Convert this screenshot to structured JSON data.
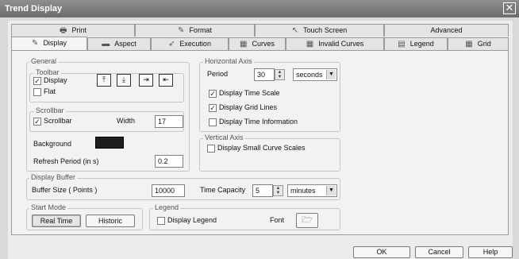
{
  "window": {
    "title": "Trend Display",
    "close_label": "✕"
  },
  "tabs_row1": [
    {
      "label": "Print",
      "icon": "printer-icon",
      "glyph": "🖶"
    },
    {
      "label": "Format",
      "icon": "pen-format-icon",
      "glyph": "✎"
    },
    {
      "label": "Touch Screen",
      "icon": "touch-pointer-icon",
      "glyph": "↖"
    },
    {
      "label": "Advanced",
      "icon": "",
      "glyph": ""
    }
  ],
  "tabs_row2": [
    {
      "label": "Display",
      "icon": "pencil-icon",
      "glyph": "✎",
      "active": true
    },
    {
      "label": "Aspect",
      "icon": "aspect-icon",
      "glyph": "▬"
    },
    {
      "label": "Execution",
      "icon": "execution-icon",
      "glyph": "➶"
    },
    {
      "label": "Curves",
      "icon": "curves-grid-icon",
      "glyph": "▦"
    },
    {
      "label": "Invalid Curves",
      "icon": "invalid-curves-icon",
      "glyph": "▦"
    },
    {
      "label": "Legend",
      "icon": "legend-icon",
      "glyph": "▤"
    },
    {
      "label": "Grid",
      "icon": "grid-icon",
      "glyph": "▦"
    }
  ],
  "general": {
    "title": "General",
    "toolbar": {
      "title": "Toolbar",
      "display_label": "Display",
      "display_checked": true,
      "flat_label": "Flat",
      "flat_checked": false,
      "buttons": [
        {
          "name": "toolbar-top-icon",
          "glyph": "⤒"
        },
        {
          "name": "toolbar-bottom-icon",
          "glyph": "⤓"
        },
        {
          "name": "toolbar-right-icon",
          "glyph": "⇥"
        },
        {
          "name": "toolbar-left-icon",
          "glyph": "⇤"
        }
      ]
    },
    "scrollbar": {
      "title": "Scrollbar",
      "scrollbar_label": "Scrollbar",
      "scrollbar_checked": true,
      "width_label": "Width",
      "width_value": "17"
    },
    "background_label": "Background",
    "background_color": "#1e1e1e",
    "refresh_label": "Refresh Period (in s)",
    "refresh_value": "0.2"
  },
  "horizontal_axis": {
    "title": "Horizontal Axis",
    "period_label": "Period",
    "period_value": "30",
    "period_unit": "seconds",
    "display_time_scale_label": "Display Time Scale",
    "display_time_scale_checked": true,
    "display_grid_lines_label": "Display Grid Lines",
    "display_grid_lines_checked": true,
    "display_time_info_label": "Display Time Information",
    "display_time_info_checked": false
  },
  "vertical_axis": {
    "title": "Vertical Axis",
    "small_scales_label": "Display Small Curve Scales",
    "small_scales_checked": false
  },
  "display_buffer": {
    "title": "Display Buffer",
    "buffer_size_label": "Buffer Size ( Points )",
    "buffer_size_value": "10000",
    "time_capacity_label": "Time Capacity",
    "time_capacity_value": "5",
    "time_capacity_unit": "minutes"
  },
  "start_mode": {
    "title": "Start Mode",
    "real_time_label": "Real Time",
    "historic_label": "Historic"
  },
  "legend_group": {
    "title": "Legend",
    "display_legend_label": "Display Legend",
    "display_legend_checked": false,
    "font_label": "Font"
  },
  "footer": {
    "ok_label": "OK",
    "cancel_label": "Cancel",
    "help_label": "Help"
  }
}
